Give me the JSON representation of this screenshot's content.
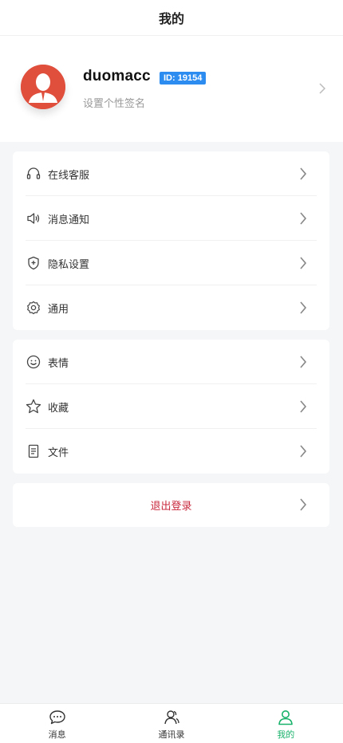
{
  "header": {
    "title": "我的"
  },
  "profile": {
    "username": "duomacc",
    "id_badge": "ID: 19154",
    "signature": "设置个性签名"
  },
  "menu_group_1": [
    {
      "label": "在线客服",
      "icon": "headset-icon"
    },
    {
      "label": "消息通知",
      "icon": "speaker-icon"
    },
    {
      "label": "隐私设置",
      "icon": "shield-plus-icon"
    },
    {
      "label": "通用",
      "icon": "gear-icon"
    }
  ],
  "menu_group_2": [
    {
      "label": "表情",
      "icon": "smiley-icon"
    },
    {
      "label": "收藏",
      "icon": "star-icon"
    },
    {
      "label": "文件",
      "icon": "document-icon"
    }
  ],
  "logout": {
    "label": "退出登录"
  },
  "tabbar": {
    "tabs": [
      {
        "label": "消息",
        "icon": "chat-bubble-icon",
        "active": false
      },
      {
        "label": "通讯录",
        "icon": "contacts-icon",
        "active": false
      },
      {
        "label": "我的",
        "icon": "user-icon",
        "active": true
      }
    ]
  },
  "colors": {
    "accent_green": "#19b26b",
    "id_badge_blue": "#2d8cf0",
    "logout_red": "#c8283c",
    "avatar_red": "#e04e3c",
    "page_bg": "#f5f6f8"
  }
}
